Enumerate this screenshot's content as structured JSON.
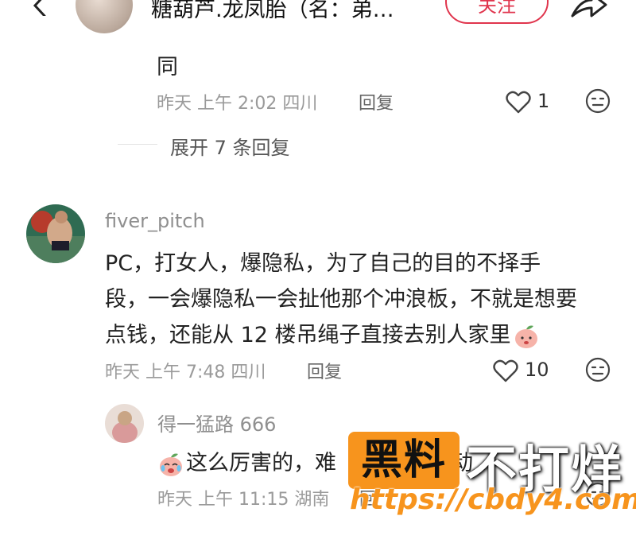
{
  "header": {
    "title": "糖葫芦.龙凤胎（名：弟…",
    "follow_label": "关注"
  },
  "comment_top": {
    "text": "同",
    "time": "昨天 上午 2:02 四川",
    "reply_label": "回复",
    "like_count": "1",
    "expand_label": "展开 7 条回复"
  },
  "comment_main": {
    "username": "fiver_pitch",
    "lines": [
      "PC，打女人，爆隐私，为了自己的目的不择手",
      "段，一会爆隐私一会扯他那个冲浪板，不就是想要",
      "点钱，还能从 12 楼吊绳子直接去别人家里"
    ],
    "time": "昨天 上午 7:48 四川",
    "reply_label": "回复",
    "like_count": "10"
  },
  "comment_reply": {
    "username": "得一猛路 666",
    "text_start": "这么厉害的，难",
    "text_end": "动",
    "time": "昨天 上午 11:15 湖南",
    "reply_label": "回"
  },
  "watermark": {
    "box": "黑料",
    "text": "不打烊",
    "url": "https://cbdy4.com"
  },
  "colors": {
    "accent": "#e0354d",
    "watermark_orange": "#f7941d"
  }
}
